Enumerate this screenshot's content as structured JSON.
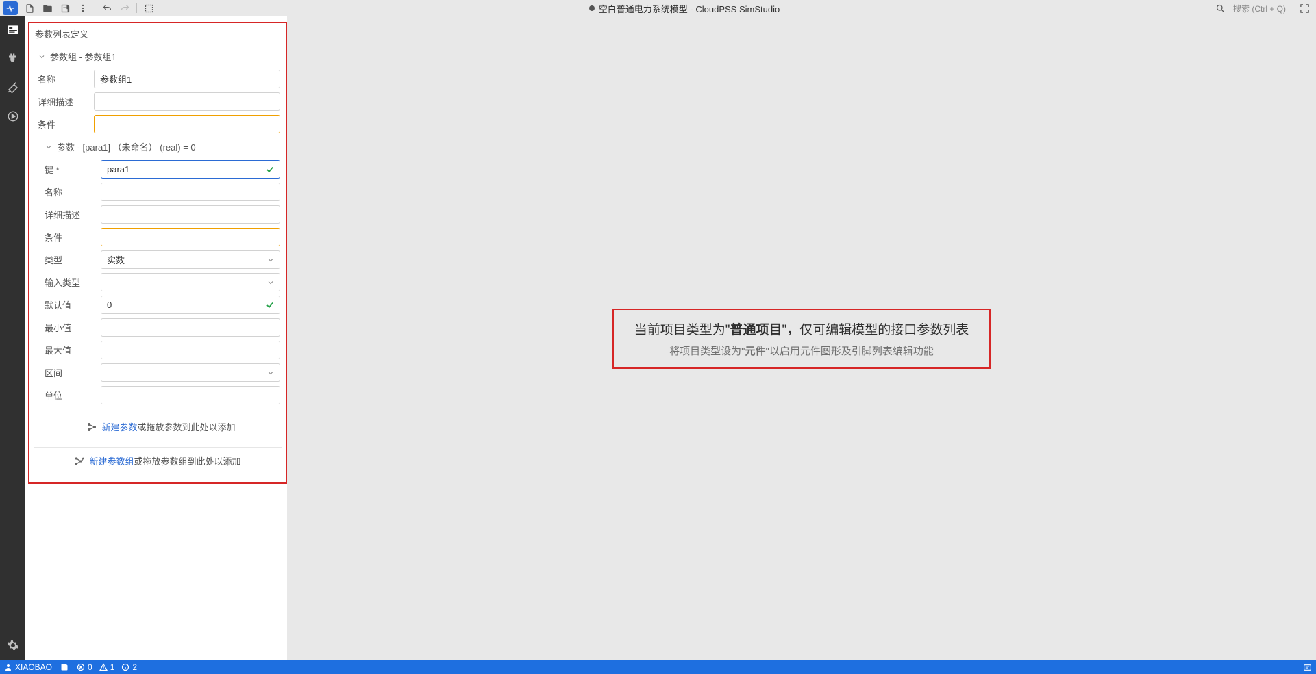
{
  "topbar": {
    "title": "空白普通电力系统模型 - CloudPSS SimStudio",
    "search_placeholder": "搜索 (Ctrl + Q)"
  },
  "panel": {
    "title": "参数列表定义",
    "group_header": "参数组 - 参数组1",
    "group_fields": {
      "name_label": "名称",
      "name_value": "参数组1",
      "desc_label": "详细描述",
      "desc_value": "",
      "cond_label": "条件",
      "cond_value": ""
    },
    "param_header": "参数 - [para1] （未命名） (real)  = 0",
    "param_fields": {
      "key_label": "键 *",
      "key_value": "para1",
      "name_label": "名称",
      "name_value": "",
      "desc_label": "详细描述",
      "desc_value": "",
      "cond_label": "条件",
      "cond_value": "",
      "type_label": "类型",
      "type_value": "实数",
      "input_type_label": "输入类型",
      "input_type_value": "",
      "default_label": "默认值",
      "default_value": "0",
      "min_label": "最小值",
      "min_value": "",
      "max_label": "最大值",
      "max_value": "",
      "interval_label": "区间",
      "interval_value": "",
      "unit_label": "单位",
      "unit_value": ""
    },
    "add_param_link": "新建参数",
    "add_param_suffix": "或拖放参数到此处以添加",
    "add_group_link": "新建参数组",
    "add_group_suffix": "或拖放参数组到此处以添加"
  },
  "notice": {
    "line1_pre": "当前项目类型为\"",
    "line1_bold": "普通项目",
    "line1_post": "\"，仅可编辑模型的接口参数列表",
    "line2_pre": "将项目类型设为\"",
    "line2_bold": "元件",
    "line2_post": "\"以启用元件图形及引脚列表编辑功能"
  },
  "status": {
    "user": "XIAOBAO",
    "err_count": "0",
    "warn_count": "1",
    "info_count": "2"
  }
}
